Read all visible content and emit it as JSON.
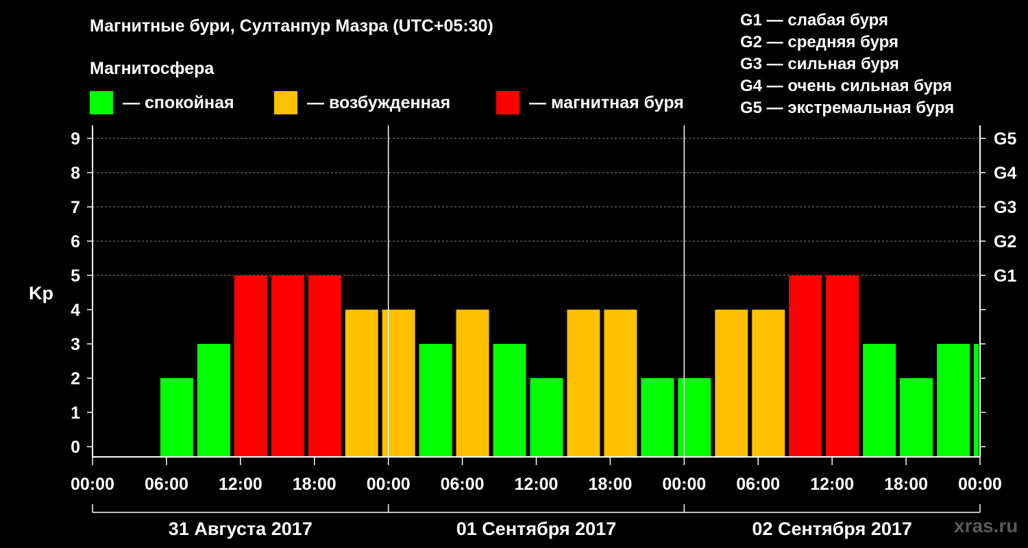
{
  "header": {
    "title": "Магнитные бури, Султанпур Мазра (UTC+05:30)",
    "magnetosphere_label": "Магнитосфера"
  },
  "legend": [
    {
      "label": "— спокойная",
      "color": "#00ff00"
    },
    {
      "label": "— возбужденная",
      "color": "#ffc000"
    },
    {
      "label": "— магнитная буря",
      "color": "#ff0000"
    }
  ],
  "g_scale": [
    "G1 — слабая буря",
    "G2 — средняя буря",
    "G3 — сильная буря",
    "G4 — очень сильная буря",
    "G5 — экстремальная буря"
  ],
  "watermark": "xras.ru",
  "chart_data": {
    "type": "bar",
    "ylabel": "Kp",
    "ylim": [
      0,
      9
    ],
    "y_ticks": [
      "0",
      "1",
      "2",
      "3",
      "4",
      "5",
      "6",
      "7",
      "8",
      "9"
    ],
    "g_levels": [
      {
        "kp": 5,
        "label": "G1"
      },
      {
        "kp": 6,
        "label": "G2"
      },
      {
        "kp": 7,
        "label": "G3"
      },
      {
        "kp": 8,
        "label": "G4"
      },
      {
        "kp": 9,
        "label": "G5"
      }
    ],
    "x_tick_labels": [
      "00:00",
      "06:00",
      "12:00",
      "18:00",
      "00:00",
      "06:00",
      "12:00",
      "18:00",
      "00:00",
      "06:00",
      "12:00",
      "18:00",
      "00:00"
    ],
    "days": [
      "31 Августа 2017",
      "01 Сентября 2017",
      "02 Сентября 2017"
    ],
    "interval_hours": 3,
    "colors": {
      "quiet": "#00ff00",
      "active": "#ffc000",
      "storm": "#ff0000"
    },
    "bars": [
      {
        "start_hour": 5.5,
        "kp": 2,
        "level": "quiet"
      },
      {
        "start_hour": 8.5,
        "kp": 3,
        "level": "quiet"
      },
      {
        "start_hour": 11.5,
        "kp": 5,
        "level": "storm"
      },
      {
        "start_hour": 14.5,
        "kp": 5,
        "level": "storm"
      },
      {
        "start_hour": 17.5,
        "kp": 5,
        "level": "storm"
      },
      {
        "start_hour": 20.5,
        "kp": 4,
        "level": "active"
      },
      {
        "start_hour": 23.5,
        "kp": 4,
        "level": "active"
      },
      {
        "start_hour": 26.5,
        "kp": 3,
        "level": "quiet"
      },
      {
        "start_hour": 29.5,
        "kp": 4,
        "level": "active"
      },
      {
        "start_hour": 32.5,
        "kp": 3,
        "level": "quiet"
      },
      {
        "start_hour": 35.5,
        "kp": 2,
        "level": "quiet"
      },
      {
        "start_hour": 38.5,
        "kp": 4,
        "level": "active"
      },
      {
        "start_hour": 41.5,
        "kp": 4,
        "level": "active"
      },
      {
        "start_hour": 44.5,
        "kp": 2,
        "level": "quiet"
      },
      {
        "start_hour": 47.5,
        "kp": 2,
        "level": "quiet"
      },
      {
        "start_hour": 50.5,
        "kp": 4,
        "level": "active"
      },
      {
        "start_hour": 53.5,
        "kp": 4,
        "level": "active"
      },
      {
        "start_hour": 56.5,
        "kp": 5,
        "level": "storm"
      },
      {
        "start_hour": 59.5,
        "kp": 5,
        "level": "storm"
      },
      {
        "start_hour": 62.5,
        "kp": 3,
        "level": "quiet"
      },
      {
        "start_hour": 65.5,
        "kp": 2,
        "level": "quiet"
      },
      {
        "start_hour": 68.5,
        "kp": 3,
        "level": "quiet"
      },
      {
        "start_hour": 71.5,
        "kp": 3,
        "level": "quiet"
      }
    ]
  }
}
